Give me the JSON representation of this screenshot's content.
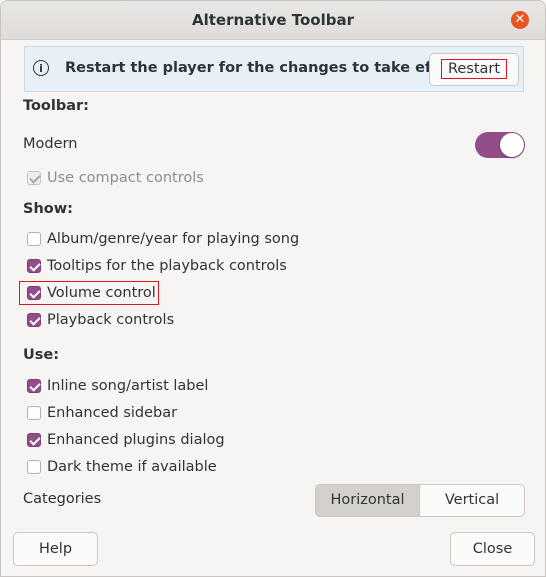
{
  "window": {
    "title": "Alternative Toolbar",
    "close_icon": "close-icon"
  },
  "infobar": {
    "message": "Restart the player for the changes to take effect.",
    "restart_label": "Restart",
    "icon": "info-icon"
  },
  "toolbar": {
    "heading": "Toolbar:",
    "style_label": "Modern",
    "style_switch_on": true,
    "compact_label": "Use compact controls",
    "compact_checked": true,
    "compact_disabled": true
  },
  "show": {
    "heading": "Show:",
    "items": [
      {
        "label": "Album/genre/year for playing song",
        "checked": false
      },
      {
        "label": "Tooltips for the playback controls",
        "checked": true
      },
      {
        "label": "Volume control",
        "checked": true
      },
      {
        "label": "Playback controls",
        "checked": true
      }
    ]
  },
  "use": {
    "heading": "Use:",
    "items": [
      {
        "label": "Inline song/artist label",
        "checked": true
      },
      {
        "label": "Enhanced sidebar",
        "checked": false
      },
      {
        "label": "Enhanced plugins dialog",
        "checked": true
      },
      {
        "label": "Dark theme if available",
        "checked": false
      }
    ]
  },
  "categories": {
    "label": "Categories",
    "options": [
      "Horizontal",
      "Vertical"
    ],
    "selected": "Horizontal"
  },
  "footer": {
    "help_label": "Help",
    "close_label": "Close"
  },
  "colors": {
    "accent": "#924d8b",
    "close_button": "#e95420",
    "highlight": "#e0161f"
  }
}
